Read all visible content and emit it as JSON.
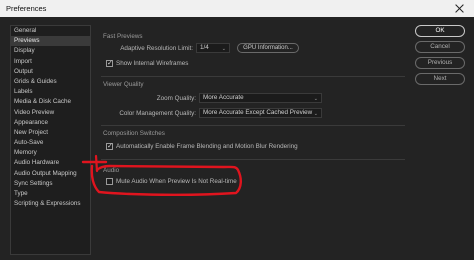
{
  "window": {
    "title": "Preferences"
  },
  "sidebar": {
    "items": [
      {
        "label": "General"
      },
      {
        "label": "Previews",
        "selected": true
      },
      {
        "label": "Display"
      },
      {
        "label": "Import"
      },
      {
        "label": "Output"
      },
      {
        "label": "Grids & Guides"
      },
      {
        "label": "Labels"
      },
      {
        "label": "Media & Disk Cache"
      },
      {
        "label": "Video Preview"
      },
      {
        "label": "Appearance"
      },
      {
        "label": "New Project"
      },
      {
        "label": "Auto-Save"
      },
      {
        "label": "Memory"
      },
      {
        "label": "Audio Hardware"
      },
      {
        "label": "Audio Output Mapping"
      },
      {
        "label": "Sync Settings"
      },
      {
        "label": "Type"
      },
      {
        "label": "Scripting & Expressions"
      }
    ]
  },
  "fast_previews": {
    "title": "Fast Previews",
    "adaptive_label": "Adaptive Resolution Limit:",
    "adaptive_value": "1/4",
    "gpu_button": "GPU Information...",
    "wireframes_label": "Show Internal Wireframes",
    "wireframes_checked": true
  },
  "viewer_quality": {
    "title": "Viewer Quality",
    "zoom_label": "Zoom Quality:",
    "zoom_value": "More Accurate",
    "color_label": "Color Management Quality:",
    "color_value": "More Accurate Except Cached Preview"
  },
  "composition_switches": {
    "title": "Composition Switches",
    "auto_enable_label": "Automatically Enable Frame Blending and Motion Blur Rendering",
    "auto_enable_checked": true
  },
  "audio": {
    "title": "Audio",
    "mute_label": "Mute Audio When Preview Is Not Real-time",
    "mute_checked": false
  },
  "buttons": {
    "ok": "OK",
    "cancel": "Cancel",
    "previous": "Previous",
    "next": "Next"
  },
  "colors": {
    "background": "#232323",
    "annotation": "#e0141e"
  }
}
